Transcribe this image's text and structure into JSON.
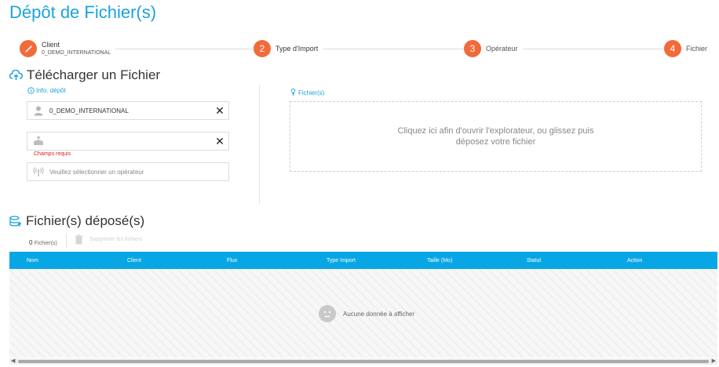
{
  "page": {
    "title": "Dépôt de Fichier(s)"
  },
  "stepper": {
    "steps": [
      {
        "number": "",
        "label": "Client",
        "sub": "0_DEMO_INTERNATIONAL"
      },
      {
        "number": "2",
        "label": "Type d'Import"
      },
      {
        "number": "3",
        "label": "Opérateur"
      },
      {
        "number": "4",
        "label": "Fichier"
      }
    ]
  },
  "upload": {
    "title": "Télécharger un Fichier",
    "info_link": "Info. dépôt",
    "client_value": "0_DEMO_INTERNATIONAL",
    "import_type_value": "",
    "required_error": "Champs requis",
    "operator_placeholder": "Veuillez sélectionner un opérateur",
    "files_label": "Fichier(s)",
    "dropzone_line1": "Cliquez ici afin d'ouvrir l'explorateur, ou glissez puis",
    "dropzone_line2": "déposez votre fichier"
  },
  "deposited": {
    "title": "Fichier(s) déposé(s)",
    "count": "0",
    "count_label": "Fichier(s)",
    "delete_label": "Supprimer les fichiers",
    "columns": [
      "Nom",
      "Client",
      "Flux",
      "Type Import",
      "Taille (Mo)",
      "Statut",
      "Action"
    ],
    "empty_text": "Aucune donnée à afficher"
  },
  "colors": {
    "accent": "#1aa3dc",
    "step": "#f26a39",
    "header": "#08a6e4",
    "error": "#d9231f"
  }
}
